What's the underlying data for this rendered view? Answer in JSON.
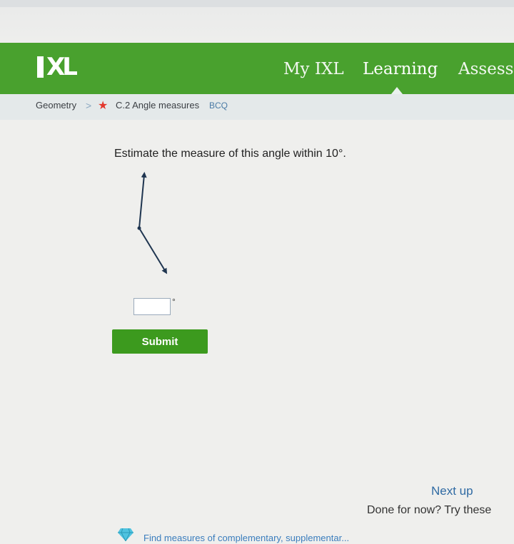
{
  "nav": {
    "logo_text": "IXL",
    "links": [
      {
        "label": "My IXL"
      },
      {
        "label": "Learning"
      },
      {
        "label": "Assessı"
      }
    ]
  },
  "breadcrumb": {
    "subject": "Geometry",
    "separator": ">",
    "skill": "C.2 Angle measures",
    "code": "BCQ"
  },
  "question": {
    "prompt": "Estimate the measure of this angle within 10°.",
    "answer_value": "",
    "unit": "°"
  },
  "actions": {
    "submit_label": "Submit"
  },
  "next_up": {
    "title": "Next up",
    "subtitle": "Done for now? Try these",
    "recommendation": "Find measures of complementary, supplementar..."
  },
  "colors": {
    "brand_green": "#49a12e",
    "submit_green": "#3c9a1e",
    "link_blue": "#2f6aa3"
  }
}
